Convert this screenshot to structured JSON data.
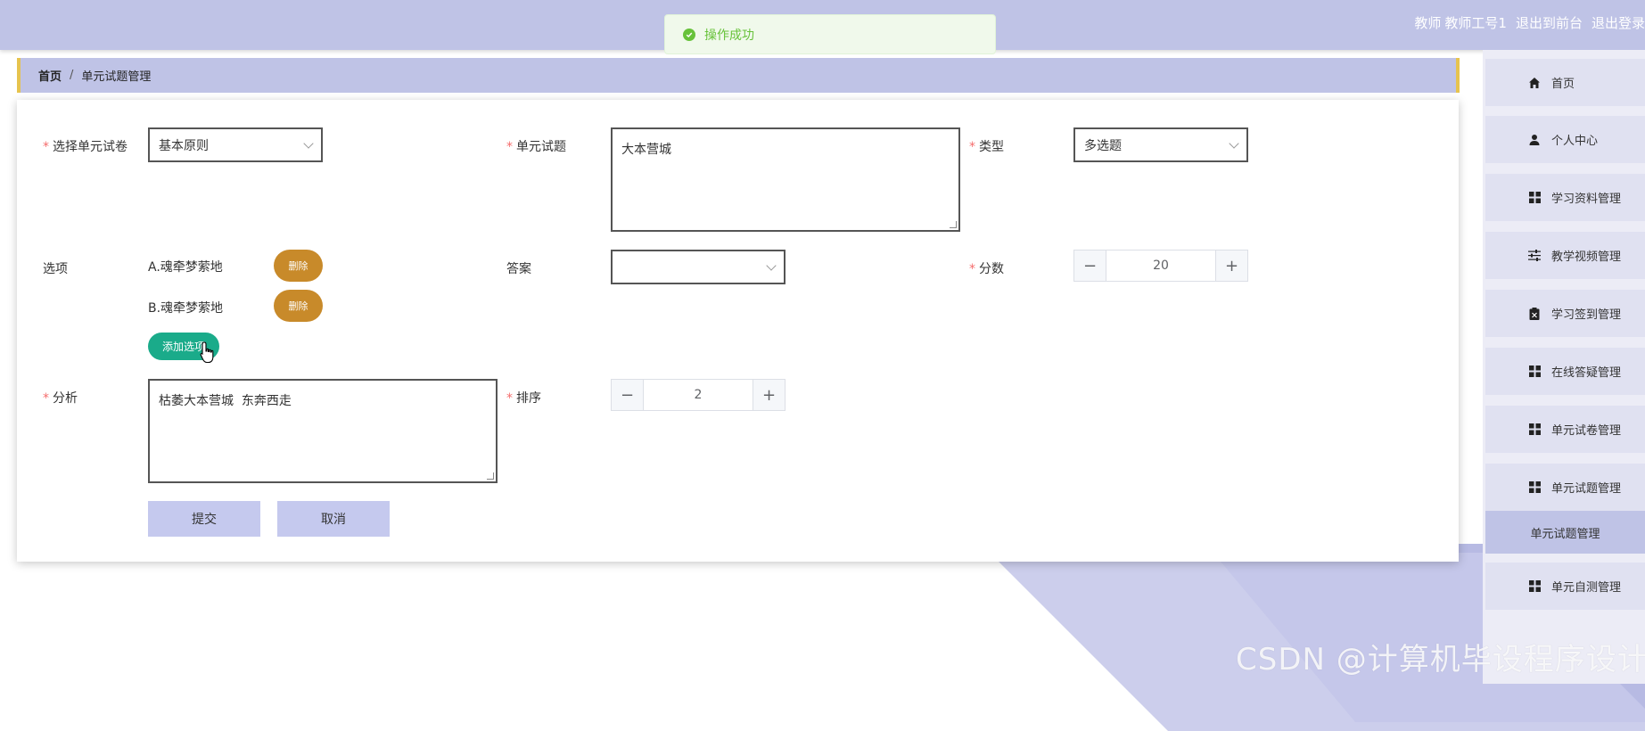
{
  "header": {
    "role": "教师",
    "username": "教师工号1",
    "front_link": "退出到前台",
    "logout_link": "退出登录"
  },
  "toast": {
    "message": "操作成功"
  },
  "breadcrumb": {
    "home": "首页",
    "separator": "/",
    "current": "单元试题管理"
  },
  "form": {
    "paper_label": "选择单元试卷",
    "paper_value": "基本原则",
    "question_label": "单元试题",
    "question_value": "大本营城",
    "type_label": "类型",
    "type_value": "多选题",
    "options_label": "选项",
    "options": [
      {
        "text": "A.魂牵梦萦地",
        "delete_label": "删除"
      },
      {
        "text": "B.魂牵梦萦地",
        "delete_label": "删除"
      }
    ],
    "add_option_label": "添加选项",
    "answer_label": "答案",
    "answer_value": "",
    "score_label": "分数",
    "score_value": "20",
    "analysis_label": "分析",
    "analysis_value": "枯萎大本营城  东奔西走",
    "sort_label": "排序",
    "sort_value": "2",
    "submit_label": "提交",
    "cancel_label": "取消"
  },
  "sidebar": {
    "items": [
      {
        "label": "首页",
        "icon": "home-icon"
      },
      {
        "label": "个人中心",
        "icon": "user-icon"
      },
      {
        "label": "学习资料管理",
        "icon": "grid-icon"
      },
      {
        "label": "教学视频管理",
        "icon": "sliders-icon"
      },
      {
        "label": "学习签到管理",
        "icon": "clipboard-icon"
      },
      {
        "label": "在线答疑管理",
        "icon": "grid-icon"
      },
      {
        "label": "单元试卷管理",
        "icon": "grid-icon"
      },
      {
        "label": "单元试题管理",
        "icon": "grid-icon"
      },
      {
        "label": "单元试题管理",
        "icon": ""
      },
      {
        "label": "单元自测管理",
        "icon": "grid-icon"
      }
    ]
  },
  "watermark": "CSDN @计算机毕设程序设计",
  "colors": {
    "header_bg": "#bfc3e6",
    "accent_border": "#e6c34e",
    "delete_button": "#c88a2a",
    "add_button": "#1aab8a",
    "success": "#67c23a",
    "required": "#f56c6c"
  }
}
